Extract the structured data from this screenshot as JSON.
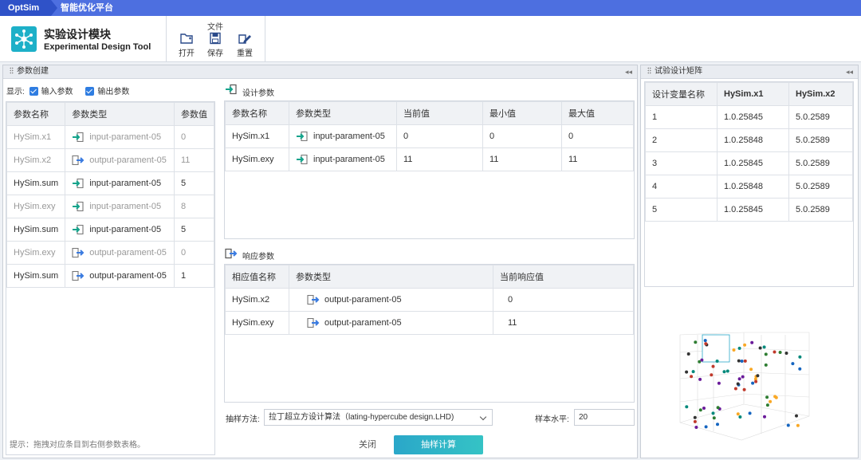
{
  "titlebar": {
    "brand": "OptSim",
    "platform": "智能优化平台"
  },
  "module": {
    "title": "实验设计模块",
    "subtitle": "Experimental Design Tool"
  },
  "ribbon": {
    "group_label": "文件",
    "open": "打开",
    "save": "保存",
    "reset": "重置"
  },
  "left": {
    "header": "参数创建",
    "show_label": "显示:",
    "input_params": "输入参数",
    "output_params": "输出参数",
    "columns": [
      "参数名称",
      "参数类型",
      "参数值"
    ],
    "rows": [
      {
        "name": "HySim.x1",
        "type": "input-parament-05",
        "value": "0",
        "dir": "in",
        "dim": true
      },
      {
        "name": "HySim.x2",
        "type": "output-parament-05",
        "value": "11",
        "dir": "out",
        "dim": true
      },
      {
        "name": "HySim.sum",
        "type": "input-parament-05",
        "value": "5",
        "dir": "in",
        "dim": false
      },
      {
        "name": "HySim.exy",
        "type": "input-parament-05",
        "value": "8",
        "dir": "in",
        "dim": true
      },
      {
        "name": "HySim.sum",
        "type": "input-parament-05",
        "value": "5",
        "dir": "in",
        "dim": false
      },
      {
        "name": "HySim.exy",
        "type": "output-parament-05",
        "value": "0",
        "dir": "out",
        "dim": true
      },
      {
        "name": "HySim.sum",
        "type": "output-parament-05",
        "value": "1",
        "dir": "out",
        "dim": false
      }
    ],
    "hint": "提示：拖拽对应条目到右侧参数表格。"
  },
  "design": {
    "title": "设计参数",
    "columns": [
      "参数名称",
      "参数类型",
      "当前值",
      "最小值",
      "最大值"
    ],
    "rows": [
      {
        "name": "HySim.x1",
        "type": "input-parament-05",
        "current": "0",
        "min": "0",
        "max": "0"
      },
      {
        "name": "HySim.exy",
        "type": "input-parament-05",
        "current": "11",
        "min": "11",
        "max": "11"
      }
    ]
  },
  "response": {
    "title": "响应参数",
    "columns": [
      "相应值名称",
      "参数类型",
      "当前响应值"
    ],
    "rows": [
      {
        "name": "HySim.x2",
        "type": "output-parament-05",
        "current": "0"
      },
      {
        "name": "HySim.exy",
        "type": "output-parament-05",
        "current": "11"
      }
    ]
  },
  "sampling": {
    "method_label": "抽样方法:",
    "method_value": "拉丁超立方设计算法（lating-hypercube design.LHD)",
    "level_label": "样本水平:",
    "level_value": "20",
    "close": "关闭",
    "compute": "抽样计算"
  },
  "matrix": {
    "header": "试验设计矩阵",
    "columns": [
      "设计变量名称",
      "HySim.x1",
      "HySim.x2"
    ],
    "rows": [
      [
        "1",
        "1.0.25845",
        "5.0.2589"
      ],
      [
        "2",
        "1.0.25848",
        "5.0.2589"
      ],
      [
        "3",
        "1.0.25845",
        "5.0.2589"
      ],
      [
        "4",
        "1.0.25848",
        "5.0.2589"
      ],
      [
        "5",
        "1.0.25845",
        "5.0.2589"
      ]
    ]
  },
  "colors": {
    "accent": "#4d6fe0",
    "brand": "#2f52c8",
    "teal": "#2aa7c9",
    "in_arrow": "#14a38b",
    "out_arrow": "#3a7be0"
  }
}
